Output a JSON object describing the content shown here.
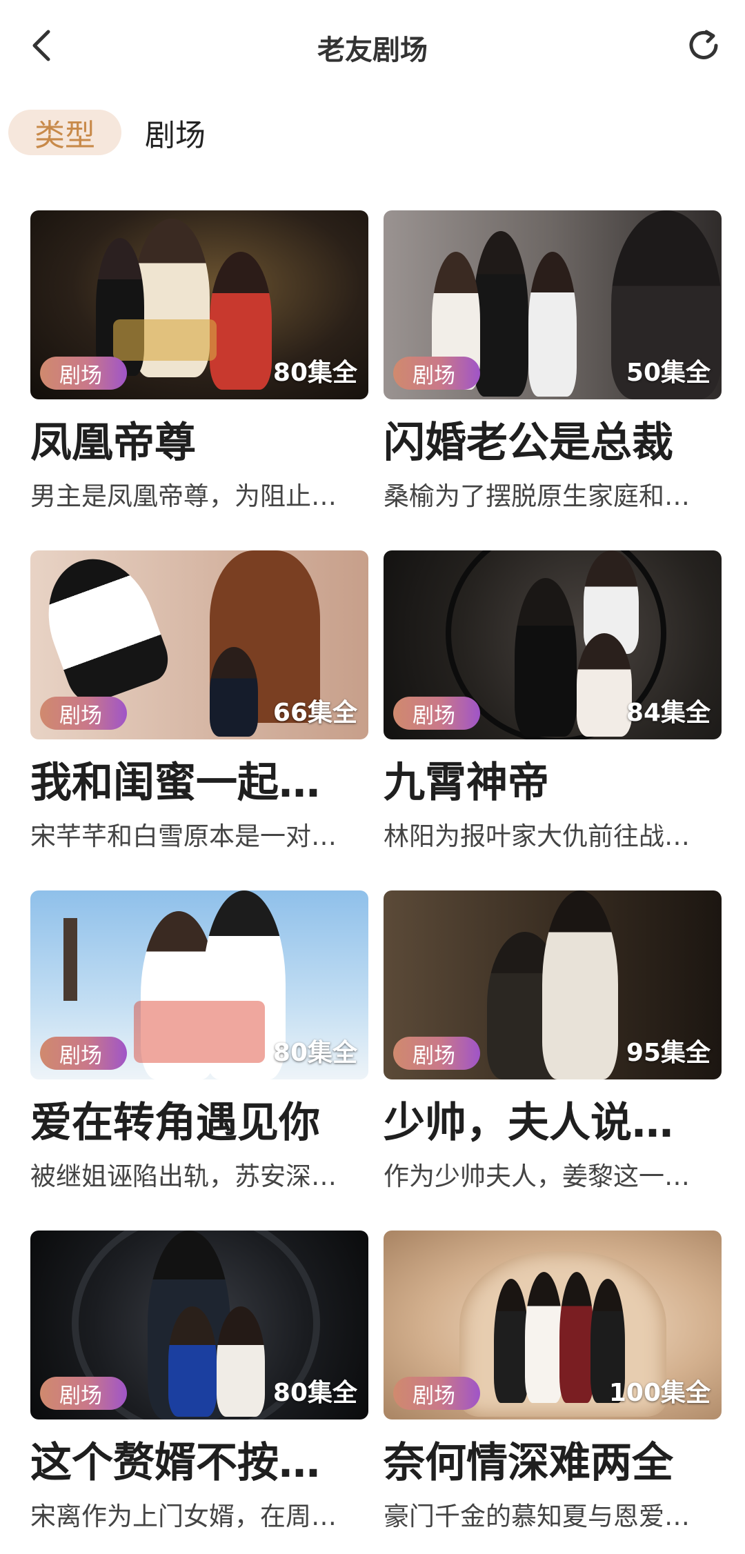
{
  "header": {
    "title": "老友剧场",
    "back_icon": "back-arrow-icon",
    "refresh_icon": "refresh-icon"
  },
  "tabs": [
    {
      "label": "类型",
      "active": true
    },
    {
      "label": "剧场",
      "active": false
    }
  ],
  "cards": [
    {
      "title": "凤凰帝尊",
      "badge": "剧场",
      "episodes": "80集全",
      "desc": "男主是凤凰帝尊，为阻止…"
    },
    {
      "title": "闪婚老公是总裁",
      "badge": "剧场",
      "episodes": "50集全",
      "desc": "桑榆为了摆脱原生家庭和…"
    },
    {
      "title": "我和闺蜜一起…",
      "badge": "剧场",
      "episodes": "66集全",
      "desc": "宋芊芊和白雪原本是一对…"
    },
    {
      "title": "九霄神帝",
      "badge": "剧场",
      "episodes": "84集全",
      "desc": "林阳为报叶家大仇前往战…"
    },
    {
      "title": "爱在转角遇见你",
      "badge": "剧场",
      "episodes": "80集全",
      "desc": "被继姐诬陷出轨，苏安深…"
    },
    {
      "title": "少帅，夫人说…",
      "badge": "剧场",
      "episodes": "95集全",
      "desc": "作为少帅夫人，姜黎这一…"
    },
    {
      "title": "这个赘婿不按…",
      "badge": "剧场",
      "episodes": "80集全",
      "desc": "宋离作为上门女婿，在周…"
    },
    {
      "title": "奈何情深难两全",
      "badge": "剧场",
      "episodes": "100集全",
      "desc": "豪门千金的慕知夏与恩爱…"
    }
  ]
}
